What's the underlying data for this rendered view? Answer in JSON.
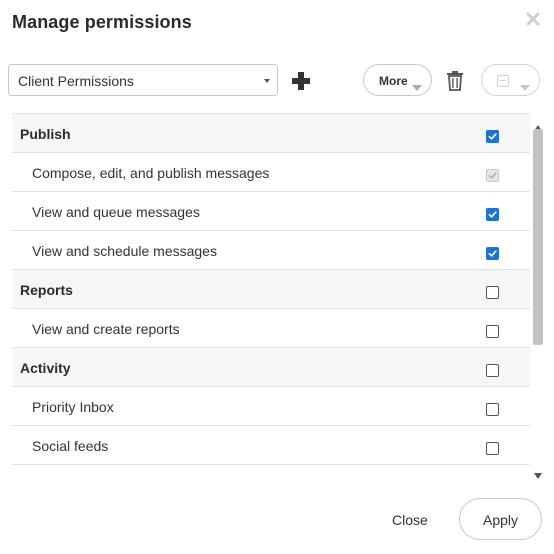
{
  "dialog": {
    "title": "Manage permissions"
  },
  "toolbar": {
    "select": {
      "value": "Client Permissions",
      "icon": "caret-down-icon"
    },
    "add_icon": "plus-icon",
    "more_label": "More",
    "trash_icon": "trash-icon",
    "bulk_icon": "bulk-select-icon"
  },
  "permissions": {
    "rows": [
      {
        "label": "Publish",
        "type": "group",
        "checked": true,
        "disabled": false
      },
      {
        "label": "Compose, edit, and publish messages",
        "type": "item",
        "checked": true,
        "disabled": true
      },
      {
        "label": "View and queue messages",
        "type": "item",
        "checked": true,
        "disabled": false
      },
      {
        "label": "View and schedule messages",
        "type": "item",
        "checked": true,
        "disabled": false
      },
      {
        "label": "Reports",
        "type": "group",
        "checked": false,
        "disabled": false
      },
      {
        "label": "View and create reports",
        "type": "item",
        "checked": false,
        "disabled": false
      },
      {
        "label": "Activity",
        "type": "group",
        "checked": false,
        "disabled": false
      },
      {
        "label": "Priority Inbox",
        "type": "item",
        "checked": false,
        "disabled": false
      },
      {
        "label": "Social feeds",
        "type": "item",
        "checked": false,
        "disabled": false
      }
    ]
  },
  "footer": {
    "close_label": "Close",
    "apply_label": "Apply"
  },
  "colors": {
    "checkbox_checked": "#1a73d9",
    "checkbox_disabled": "#e6e6e6",
    "group_row_bg": "#f6f6f6"
  }
}
